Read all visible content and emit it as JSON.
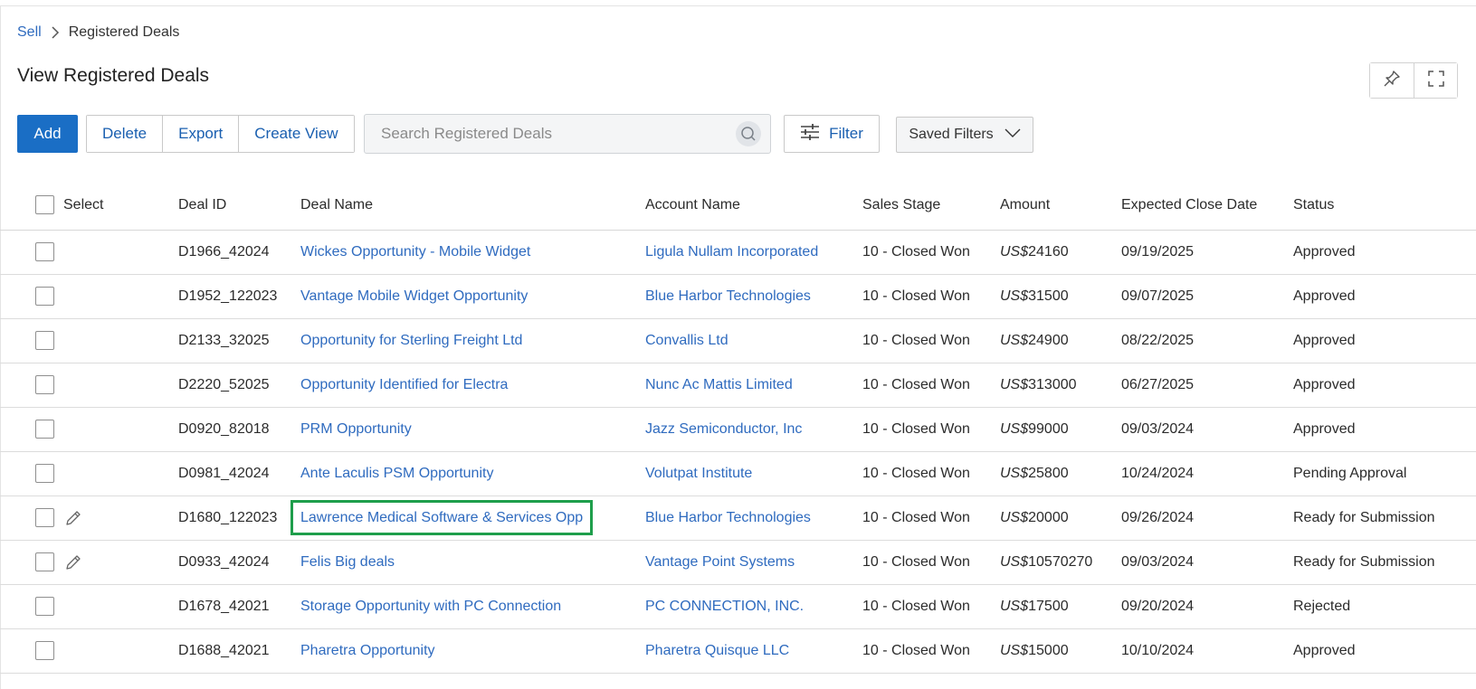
{
  "breadcrumb": {
    "parent": "Sell",
    "current": "Registered Deals"
  },
  "page_title": "View Registered Deals",
  "toolbar": {
    "add_label": "Add",
    "delete_label": "Delete",
    "export_label": "Export",
    "create_view_label": "Create View",
    "filter_label": "Filter",
    "saved_filters_label": "Saved Filters"
  },
  "search": {
    "placeholder": "Search Registered Deals",
    "value": ""
  },
  "icons": {
    "pin": "pin-icon",
    "fullscreen": "fullscreen-icon",
    "search": "search-icon",
    "filter": "sliders-icon",
    "chevron": "chevron-down-icon",
    "edit": "pencil-icon"
  },
  "colors": {
    "primary": "#1a6ec5",
    "link": "#2f6bbf",
    "highlight": "#1e9e4b"
  },
  "table": {
    "headers": {
      "select": "Select",
      "deal_id": "Deal ID",
      "deal_name": "Deal Name",
      "account_name": "Account Name",
      "sales_stage": "Sales Stage",
      "amount": "Amount",
      "close_date": "Expected Close Date",
      "status": "Status"
    },
    "rows": [
      {
        "id": "D1966_42024",
        "name": "Wickes Opportunity - Mobile Widget",
        "account": "Ligula Nullam Incorporated",
        "stage": "10 - Closed Won",
        "currency": "US$",
        "amount": "24160",
        "date": "09/19/2025",
        "status": "Approved",
        "editable": false,
        "highlighted": false
      },
      {
        "id": "D1952_122023",
        "name": "Vantage Mobile Widget Opportunity",
        "account": "Blue Harbor Technologies",
        "stage": "10 - Closed Won",
        "currency": "US$",
        "amount": "31500",
        "date": "09/07/2025",
        "status": "Approved",
        "editable": false,
        "highlighted": false
      },
      {
        "id": "D2133_32025",
        "name": "Opportunity for Sterling Freight Ltd",
        "account": "Convallis Ltd",
        "stage": "10 - Closed Won",
        "currency": "US$",
        "amount": "24900",
        "date": "08/22/2025",
        "status": "Approved",
        "editable": false,
        "highlighted": false
      },
      {
        "id": "D2220_52025",
        "name": "Opportunity Identified for Electra",
        "account": "Nunc Ac Mattis Limited",
        "stage": "10 - Closed Won",
        "currency": "US$",
        "amount": "313000",
        "date": "06/27/2025",
        "status": "Approved",
        "editable": false,
        "highlighted": false
      },
      {
        "id": "D0920_82018",
        "name": "PRM Opportunity",
        "account": "Jazz Semiconductor, Inc",
        "stage": "10 - Closed Won",
        "currency": "US$",
        "amount": "99000",
        "date": "09/03/2024",
        "status": "Approved",
        "editable": false,
        "highlighted": false
      },
      {
        "id": "D0981_42024",
        "name": "Ante Laculis PSM Opportunity",
        "account": "Volutpat Institute",
        "stage": "10 - Closed Won",
        "currency": "US$",
        "amount": "25800",
        "date": "10/24/2024",
        "status": "Pending Approval",
        "editable": false,
        "highlighted": false
      },
      {
        "id": "D1680_122023",
        "name": "Lawrence Medical Software & Services Opp",
        "account": "Blue Harbor Technologies",
        "stage": "10 - Closed Won",
        "currency": "US$",
        "amount": "20000",
        "date": "09/26/2024",
        "status": "Ready for Submission",
        "editable": true,
        "highlighted": true
      },
      {
        "id": "D0933_42024",
        "name": "Felis Big deals",
        "account": "Vantage Point Systems",
        "stage": "10 - Closed Won",
        "currency": "US$",
        "amount": "10570270",
        "date": "09/03/2024",
        "status": "Ready for Submission",
        "editable": true,
        "highlighted": false
      },
      {
        "id": "D1678_42021",
        "name": "Storage Opportunity with PC Connection",
        "account": "PC CONNECTION, INC.",
        "stage": "10 - Closed Won",
        "currency": "US$",
        "amount": "17500",
        "date": "09/20/2024",
        "status": "Rejected",
        "editable": false,
        "highlighted": false
      },
      {
        "id": "D1688_42021",
        "name": "Pharetra Opportunity",
        "account": "Pharetra Quisque LLC",
        "stage": "10 - Closed Won",
        "currency": "US$",
        "amount": "15000",
        "date": "10/10/2024",
        "status": "Approved",
        "editable": false,
        "highlighted": false
      }
    ]
  }
}
